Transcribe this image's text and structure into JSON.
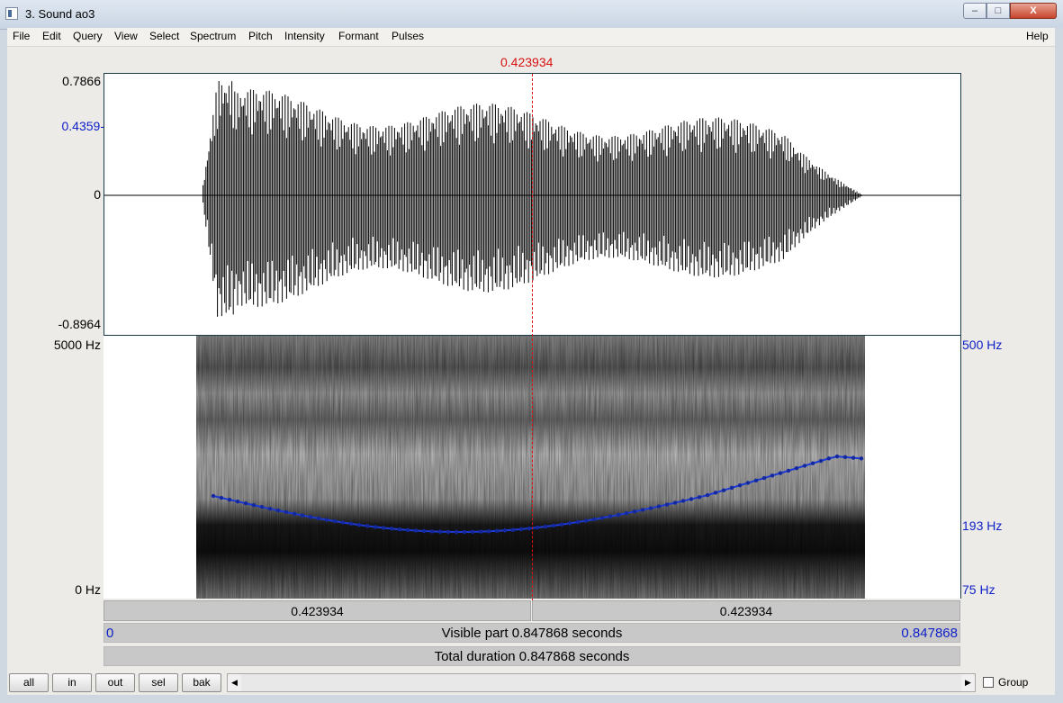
{
  "window": {
    "title": "3. Sound ao3",
    "min_glyph": "–",
    "max_glyph": "□",
    "close_glyph": "X"
  },
  "menu": {
    "items": [
      "File",
      "Edit",
      "Query",
      "View",
      "Select",
      "Spectrum",
      "Pitch",
      "Intensity",
      "Formant",
      "Pulses"
    ],
    "help": "Help"
  },
  "cursor": {
    "time_label": "0.423934",
    "color": "#d81010"
  },
  "waveform": {
    "y_max": "0.7866",
    "y_cursor": "0.4359",
    "y_zero": "0",
    "y_min": "-0.8964"
  },
  "spectrogram": {
    "freq_max": "5000 Hz",
    "freq_min": "0 Hz",
    "pitch_max": "500 Hz",
    "pitch_cursor": "193 Hz",
    "pitch_min": "75 Hz",
    "pitch_color": "#1c3ad8"
  },
  "timebars": {
    "seg_left": "0.423934",
    "seg_right": "0.423934",
    "visible_start": "0",
    "visible_label": "Visible part 0.847868 seconds",
    "visible_end": "0.847868",
    "total_label": "Total duration 0.847868 seconds"
  },
  "controls": {
    "buttons": [
      "all",
      "in",
      "out",
      "sel",
      "bak"
    ],
    "scroll_left_glyph": "◀",
    "scroll_right_glyph": "▶",
    "group_label": "Group"
  }
}
